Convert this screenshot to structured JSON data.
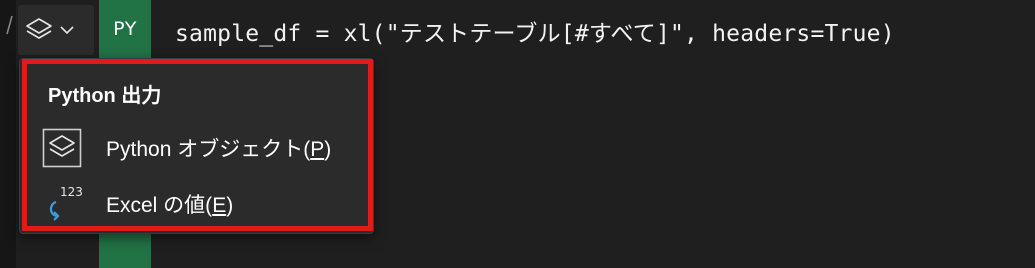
{
  "py_badge": "PY",
  "formula": "sample_df = xl(\"テストテーブル[#すべて]\", headers=True)",
  "output_selector": {
    "icon": "layers-icon",
    "chevron": "chevron-down-icon"
  },
  "menu": {
    "title": "Python 出力",
    "items": [
      {
        "label_prefix": "Python オブジェクト(",
        "accelerator": "P",
        "label_suffix": ")",
        "icon": "python-object-icon"
      },
      {
        "label_prefix": "Excel の値(",
        "accelerator": "E",
        "label_suffix": ")",
        "icon": "excel-value-icon",
        "icon_superscript": "123"
      }
    ]
  },
  "colors": {
    "background": "#1f1f1f",
    "py_green": "#217346",
    "highlight_red": "#e01b1b",
    "menu_bg": "#2b2b2b",
    "value_icon_blue": "#3b9ddd"
  }
}
